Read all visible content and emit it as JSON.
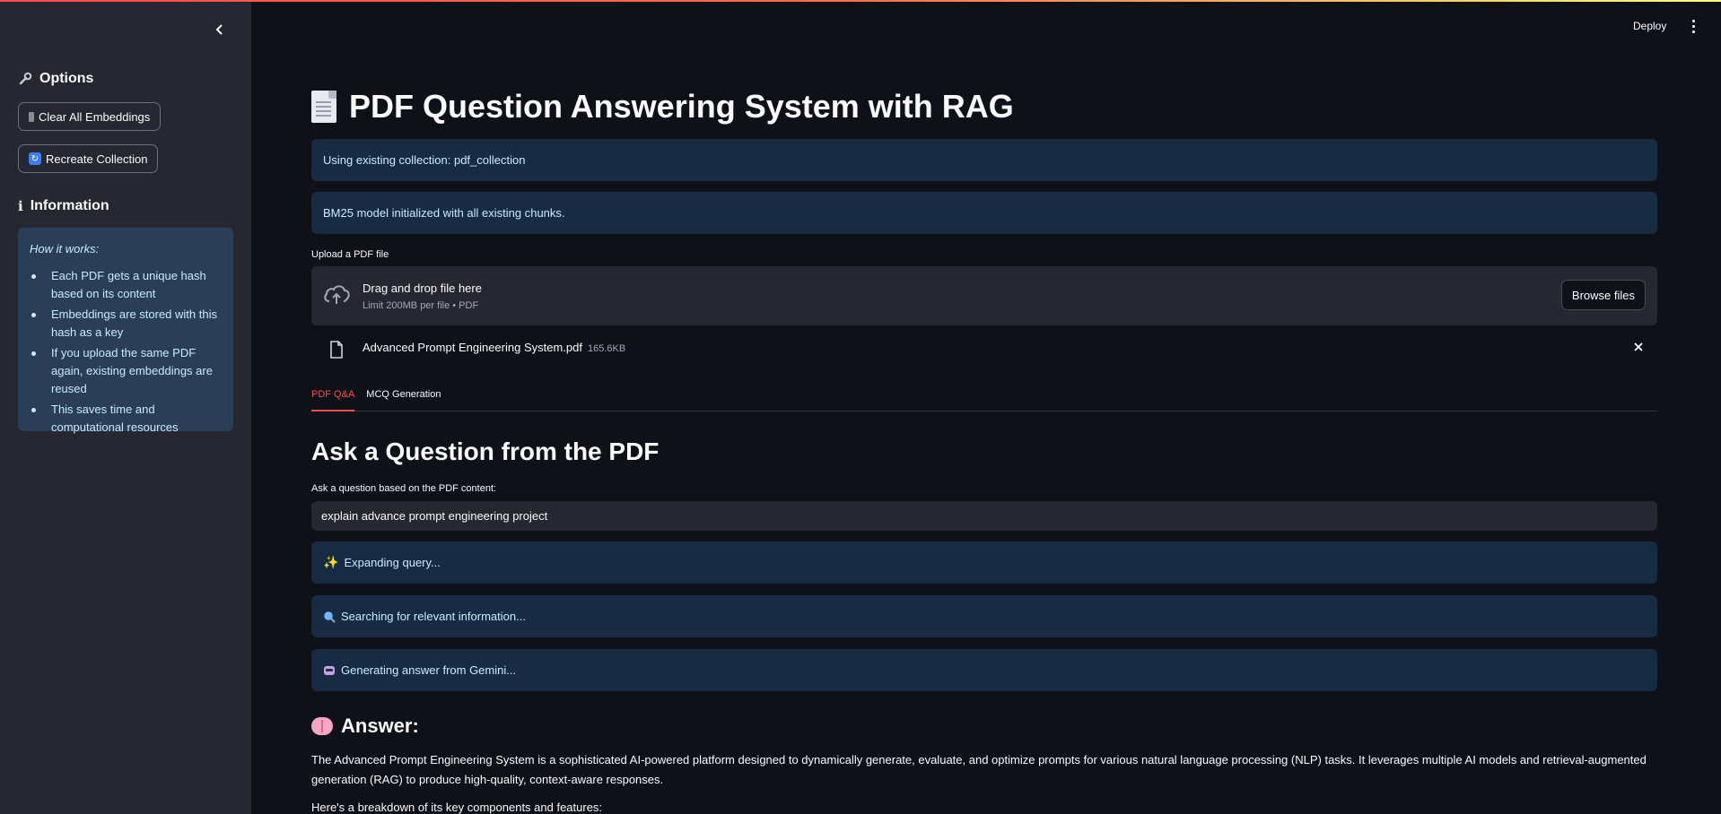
{
  "sidebar": {
    "options_title": "Options",
    "clear_button": "Clear All Embeddings",
    "recreate_button": "Recreate Collection",
    "information_title": "Information",
    "how_it_works": "How it works:",
    "items": [
      "Each PDF gets a unique hash based on its content",
      "Embeddings are stored with this hash as a key",
      "If you upload the same PDF again, existing embeddings are reused",
      "This saves time and computational resources"
    ]
  },
  "header": {
    "deploy_label": "Deploy"
  },
  "main": {
    "title": "PDF Question Answering System with RAG",
    "alerts": [
      "Using existing collection: pdf_collection",
      "BM25 model initialized with all existing chunks."
    ],
    "upload": {
      "label": "Upload a PDF file",
      "drag_text": "Drag and drop file here",
      "limit_text": "Limit 200MB per file • PDF",
      "browse_label": "Browse files",
      "file_name": "Advanced Prompt Engineering System.pdf",
      "file_size": "165.6KB"
    },
    "tabs": [
      "PDF Q&A",
      "MCQ Generation"
    ],
    "section_title": "Ask a Question from the PDF",
    "question_label": "Ask a question based on the PDF content:",
    "question_value": "explain advance prompt engineering project",
    "status": [
      "Expanding query...",
      "Searching for relevant information...",
      "Generating answer from Gemini..."
    ],
    "answer_title": "Answer:",
    "answer_text": "The Advanced Prompt Engineering System is a sophisticated AI-powered platform designed to dynamically generate, evaluate, and optimize prompts for various natural language processing (NLP) tasks. It leverages multiple AI models and retrieval-augmented generation (RAG) to produce high-quality, context-aware responses.",
    "answer_text2": "Here's a breakdown of its key components and features:"
  },
  "colors": {
    "accent": "#ff4b4b",
    "info_bg": "#1c3a5a",
    "info_text": "#c7ebff"
  },
  "icons": [
    "chevron-left-icon",
    "wrench-icon",
    "trash-icon",
    "refresh-icon",
    "info-icon",
    "document-icon",
    "cloud-upload-icon",
    "file-icon",
    "close-icon",
    "sparkles-icon",
    "magnifier-icon",
    "robot-icon",
    "brain-icon",
    "kebab-menu-icon"
  ]
}
